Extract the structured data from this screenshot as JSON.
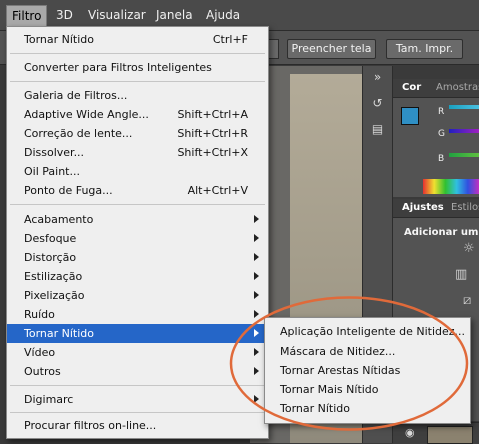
{
  "menubar": {
    "items": [
      "Filtro",
      "3D",
      "Visualizar",
      "Janela",
      "Ajuda"
    ],
    "active": "Filtro"
  },
  "options_bar": {
    "buttons": [
      "Preencher tela",
      "Tam. Impr."
    ]
  },
  "filter_menu": {
    "items": [
      {
        "label": "Tornar Nítido",
        "shortcut": "Ctrl+F"
      },
      {
        "label": "Converter para Filtros Inteligentes"
      },
      {
        "label": "Galeria de Filtros..."
      },
      {
        "label": "Adaptive Wide Angle...",
        "shortcut": "Shift+Ctrl+A"
      },
      {
        "label": "Correção de lente...",
        "shortcut": "Shift+Ctrl+R"
      },
      {
        "label": "Dissolver...",
        "shortcut": "Shift+Ctrl+X"
      },
      {
        "label": "Oil Paint..."
      },
      {
        "label": "Ponto de Fuga...",
        "shortcut": "Alt+Ctrl+V"
      },
      {
        "label": "Acabamento",
        "submenu": true
      },
      {
        "label": "Desfoque",
        "submenu": true
      },
      {
        "label": "Distorção",
        "submenu": true
      },
      {
        "label": "Estilização",
        "submenu": true
      },
      {
        "label": "Pixelização",
        "submenu": true
      },
      {
        "label": "Ruído",
        "submenu": true
      },
      {
        "label": "Tornar Nítido",
        "submenu": true,
        "highlighted": true
      },
      {
        "label": "Vídeo",
        "submenu": true
      },
      {
        "label": "Outros",
        "submenu": true
      },
      {
        "label": "Digimarc",
        "submenu": true
      },
      {
        "label": "Procurar filtros on-line..."
      }
    ]
  },
  "sharpen_submenu": {
    "items": [
      "Aplicação Inteligente de Nitidez...",
      "Máscara de Nitidez...",
      "Tornar Arestas Nítidas",
      "Tornar Mais Nítido",
      "Tornar Nítido"
    ]
  },
  "color_panel": {
    "tabs": [
      "Cor",
      "Amostras"
    ],
    "active_tab": "Cor",
    "foreground_color": "#2f8fc4",
    "channels": [
      "R",
      "G",
      "B"
    ]
  },
  "adjustments_panel": {
    "tabs": [
      "Ajustes",
      "Estilos"
    ],
    "active_tab": "Ajustes",
    "heading": "Adicionar um aj"
  },
  "colors": {
    "menu_highlight": "#2566c8",
    "annotation_oval": "#e06a3a"
  }
}
